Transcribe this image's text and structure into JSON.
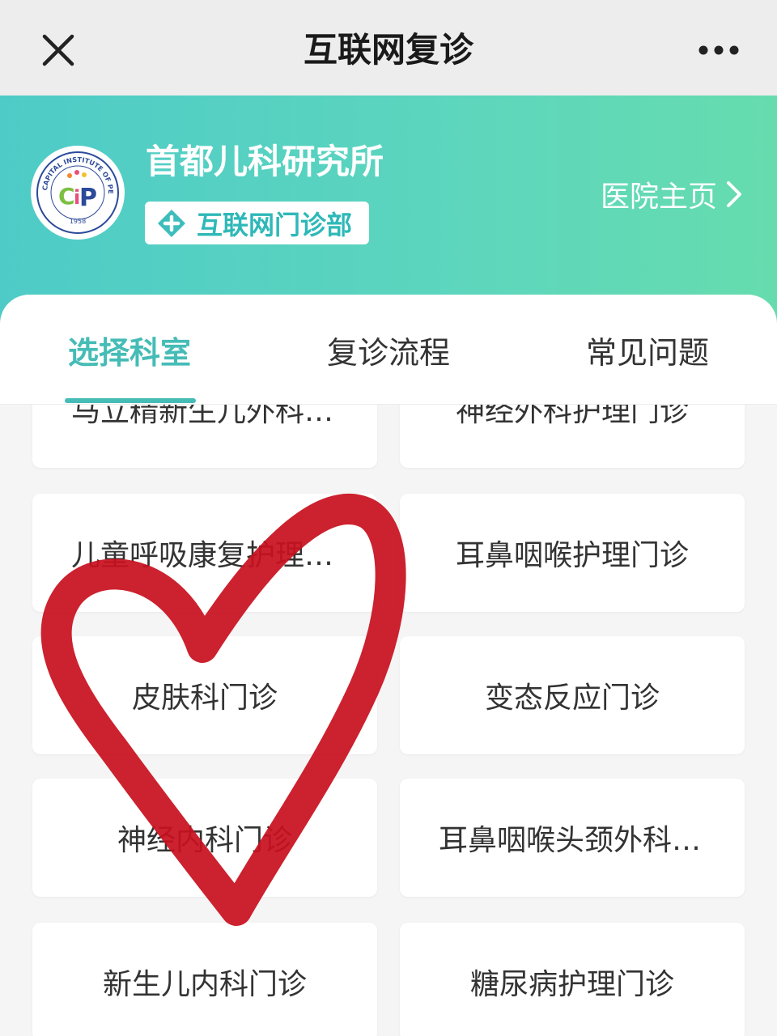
{
  "navbar": {
    "title": "互联网复诊",
    "close_icon": "close-icon",
    "more_icon": "more-dots-icon"
  },
  "hospital": {
    "name": "首都儿科研究所",
    "department_tag": "互联网门诊部",
    "home_link": "医院主页",
    "logo_text": {
      "ring": "CAPITAL INSTITUTE OF PEDIATRICS",
      "year": "1958",
      "initials": "CIP"
    }
  },
  "tabs": [
    {
      "label": "选择科室",
      "active": true
    },
    {
      "label": "复诊流程",
      "active": false
    },
    {
      "label": "常见问题",
      "active": false
    }
  ],
  "departments": [
    {
      "label": "马立精新生儿外科门诊"
    },
    {
      "label": "神经外科护理门诊"
    },
    {
      "label": "儿童呼吸康复护理门诊"
    },
    {
      "label": "耳鼻咽喉护理门诊"
    },
    {
      "label": "皮肤科门诊"
    },
    {
      "label": "变态反应门诊"
    },
    {
      "label": "神经内科门诊"
    },
    {
      "label": "耳鼻咽喉头颈外科门诊"
    },
    {
      "label": "新生儿内科门诊"
    },
    {
      "label": "糖尿病护理门诊"
    }
  ],
  "colors": {
    "accent": "#45bcb6",
    "banner_start": "#4ecbc7",
    "banner_end": "#66dcae",
    "heart": "#c8101e"
  }
}
